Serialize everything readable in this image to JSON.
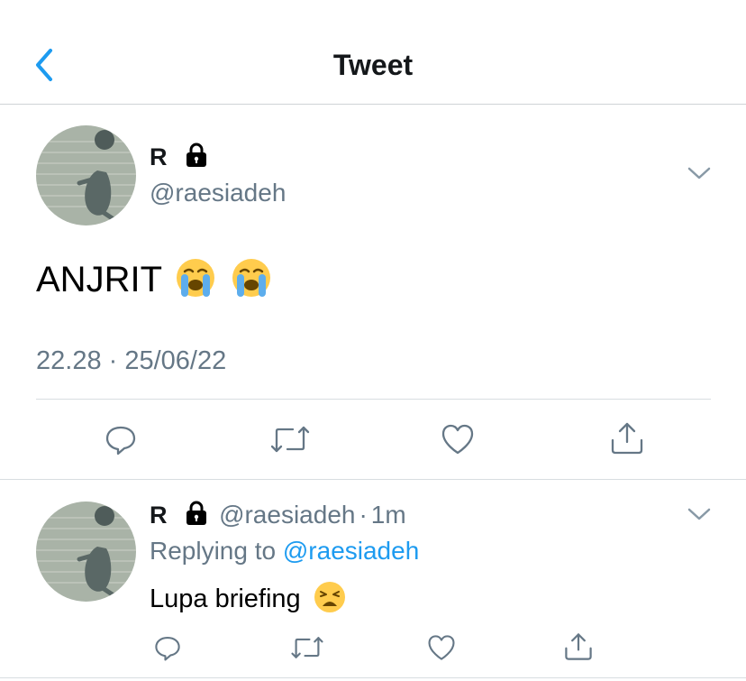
{
  "header": {
    "title": "Tweet"
  },
  "tweet": {
    "name": "R",
    "handle": "@raesiadeh",
    "text": "ANJRIT",
    "emojis": [
      "loudly-crying-face",
      "loudly-crying-face"
    ],
    "timestamp": "22.28 · 25/06/22"
  },
  "reply": {
    "name": "R",
    "handle": "@raesiadeh",
    "time_sep": "·",
    "time": "1m",
    "replying_prefix": "Replying to",
    "replying_handle": "@raesiadeh",
    "text": "Lupa briefing",
    "emoji": "weary-face"
  },
  "colors": {
    "accent": "#1d9bf0",
    "muted": "#657786",
    "divider": "#d8dde1"
  }
}
